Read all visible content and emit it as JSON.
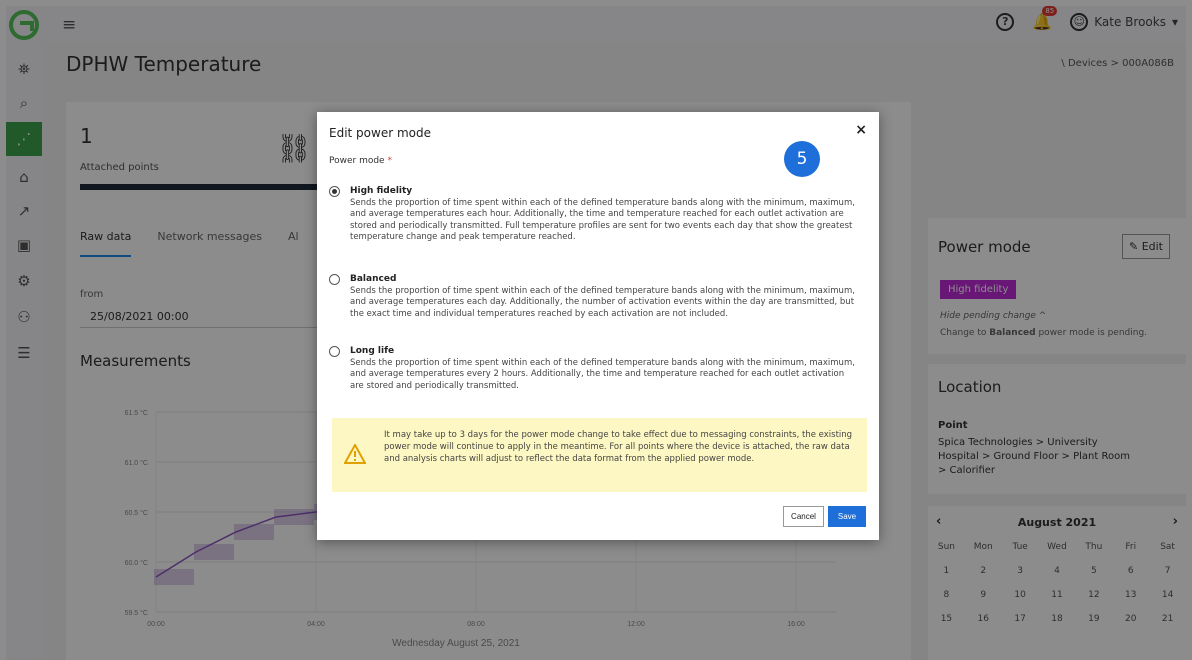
{
  "app": {
    "title": "DPHW Temperature"
  },
  "breadcrumb": "\\ Devices > 000A086B",
  "topbar": {
    "user_name": "Kate Brooks",
    "notification_count": "85",
    "help_label": "?"
  },
  "sidebar": {
    "items": [
      {
        "name": "hierarchy-icon",
        "glyph": "⛯"
      },
      {
        "name": "search-icon",
        "glyph": "⌕"
      },
      {
        "name": "devices-icon",
        "glyph": "⋰"
      },
      {
        "name": "tag-icon",
        "glyph": "⌂"
      },
      {
        "name": "chart-icon",
        "glyph": "↗"
      },
      {
        "name": "report-icon",
        "glyph": "▣"
      },
      {
        "name": "settings-icon",
        "glyph": "⚙"
      },
      {
        "name": "users-icon",
        "glyph": "⚇"
      },
      {
        "name": "filters-icon",
        "glyph": "☰"
      }
    ]
  },
  "main": {
    "attached_count": "1",
    "attached_label": "Attached points",
    "tabs": [
      "Raw data",
      "Network messages",
      "Al"
    ],
    "from_label": "from",
    "from_value": "25/08/2021 00:00",
    "measurements_title": "Measurements"
  },
  "chart_data": {
    "type": "area",
    "yticks": [
      "61.5 °C",
      "61.0 °C",
      "60.5 °C",
      "60.0 °C",
      "59.5 °C"
    ],
    "xticks": [
      "00:00",
      "04:00",
      "08:00",
      "12:00",
      "16:00"
    ],
    "xlabel": "Wednesday August 25, 2021",
    "ylim": [
      59.5,
      61.5
    ],
    "series": [
      {
        "x": [
          "00:00",
          "01:00",
          "02:00",
          "03:00",
          "04:00",
          "05:00"
        ],
        "values": [
          59.85,
          60.1,
          60.3,
          60.45,
          60.5,
          60.55
        ]
      }
    ]
  },
  "power_mode": {
    "title": "Power mode",
    "edit_label": "Edit",
    "current": "High fidelity",
    "hide_pending": "Hide pending change ^",
    "pending_prefix": "Change to ",
    "pending_mode": "Balanced",
    "pending_suffix": " power mode is pending."
  },
  "location": {
    "title": "Location",
    "point_label": "Point",
    "point_value": "Spica Technologies > University Hospital > Ground Floor > Plant Room > Calorifier"
  },
  "calendar": {
    "month": "August 2021",
    "prev": "‹",
    "next": "›",
    "days": [
      "Sun",
      "Mon",
      "Tue",
      "Wed",
      "Thu",
      "Fri",
      "Sat"
    ],
    "dates": [
      "1",
      "2",
      "3",
      "4",
      "5",
      "6",
      "7",
      "8",
      "9",
      "10",
      "11",
      "12",
      "13",
      "14",
      "15",
      "16",
      "17",
      "18",
      "19",
      "20",
      "21"
    ]
  },
  "modal": {
    "title": "Edit power mode",
    "close": "×",
    "field_label": "Power mode",
    "required_mark": "*",
    "step_number": "5",
    "options": [
      {
        "label": "High fidelity",
        "checked": true,
        "desc": "Sends the proportion of time spent within each of the defined temperature bands along with the minimum, maximum, and average temperatures each hour. Additionally, the time and temperature reached for each outlet activation are stored and periodically transmitted. Full temperature profiles are sent for two events each day that show the greatest temperature change and peak temperature reached."
      },
      {
        "label": "Balanced",
        "checked": false,
        "desc": "Sends the proportion of time spent within each of the defined temperature bands along with the minimum, maximum, and average temperatures each day. Additionally, the number of activation events within the day are transmitted, but the exact time and individual temperatures reached by each activation are not included."
      },
      {
        "label": "Long life",
        "checked": false,
        "desc": "Sends the proportion of time spent within each of the defined temperature bands along with the minimum, maximum, and average temperatures every 2 hours. Additionally, the time and temperature reached for each outlet activation are stored and periodically transmitted."
      }
    ],
    "warning": "It may take up to 3 days for the power mode change to take effect due to messaging constraints, the existing power mode will continue to apply in the meantime. For all points where the device is attached, the raw data and analysis charts will adjust to reflect the data format from the applied power mode.",
    "cancel_label": "Cancel",
    "save_label": "Save"
  },
  "colors": {
    "accent": "#1e6fd9",
    "brand": "#3fa34d",
    "tag": "#c02ad7",
    "warning_bg": "#fdf7c3"
  }
}
